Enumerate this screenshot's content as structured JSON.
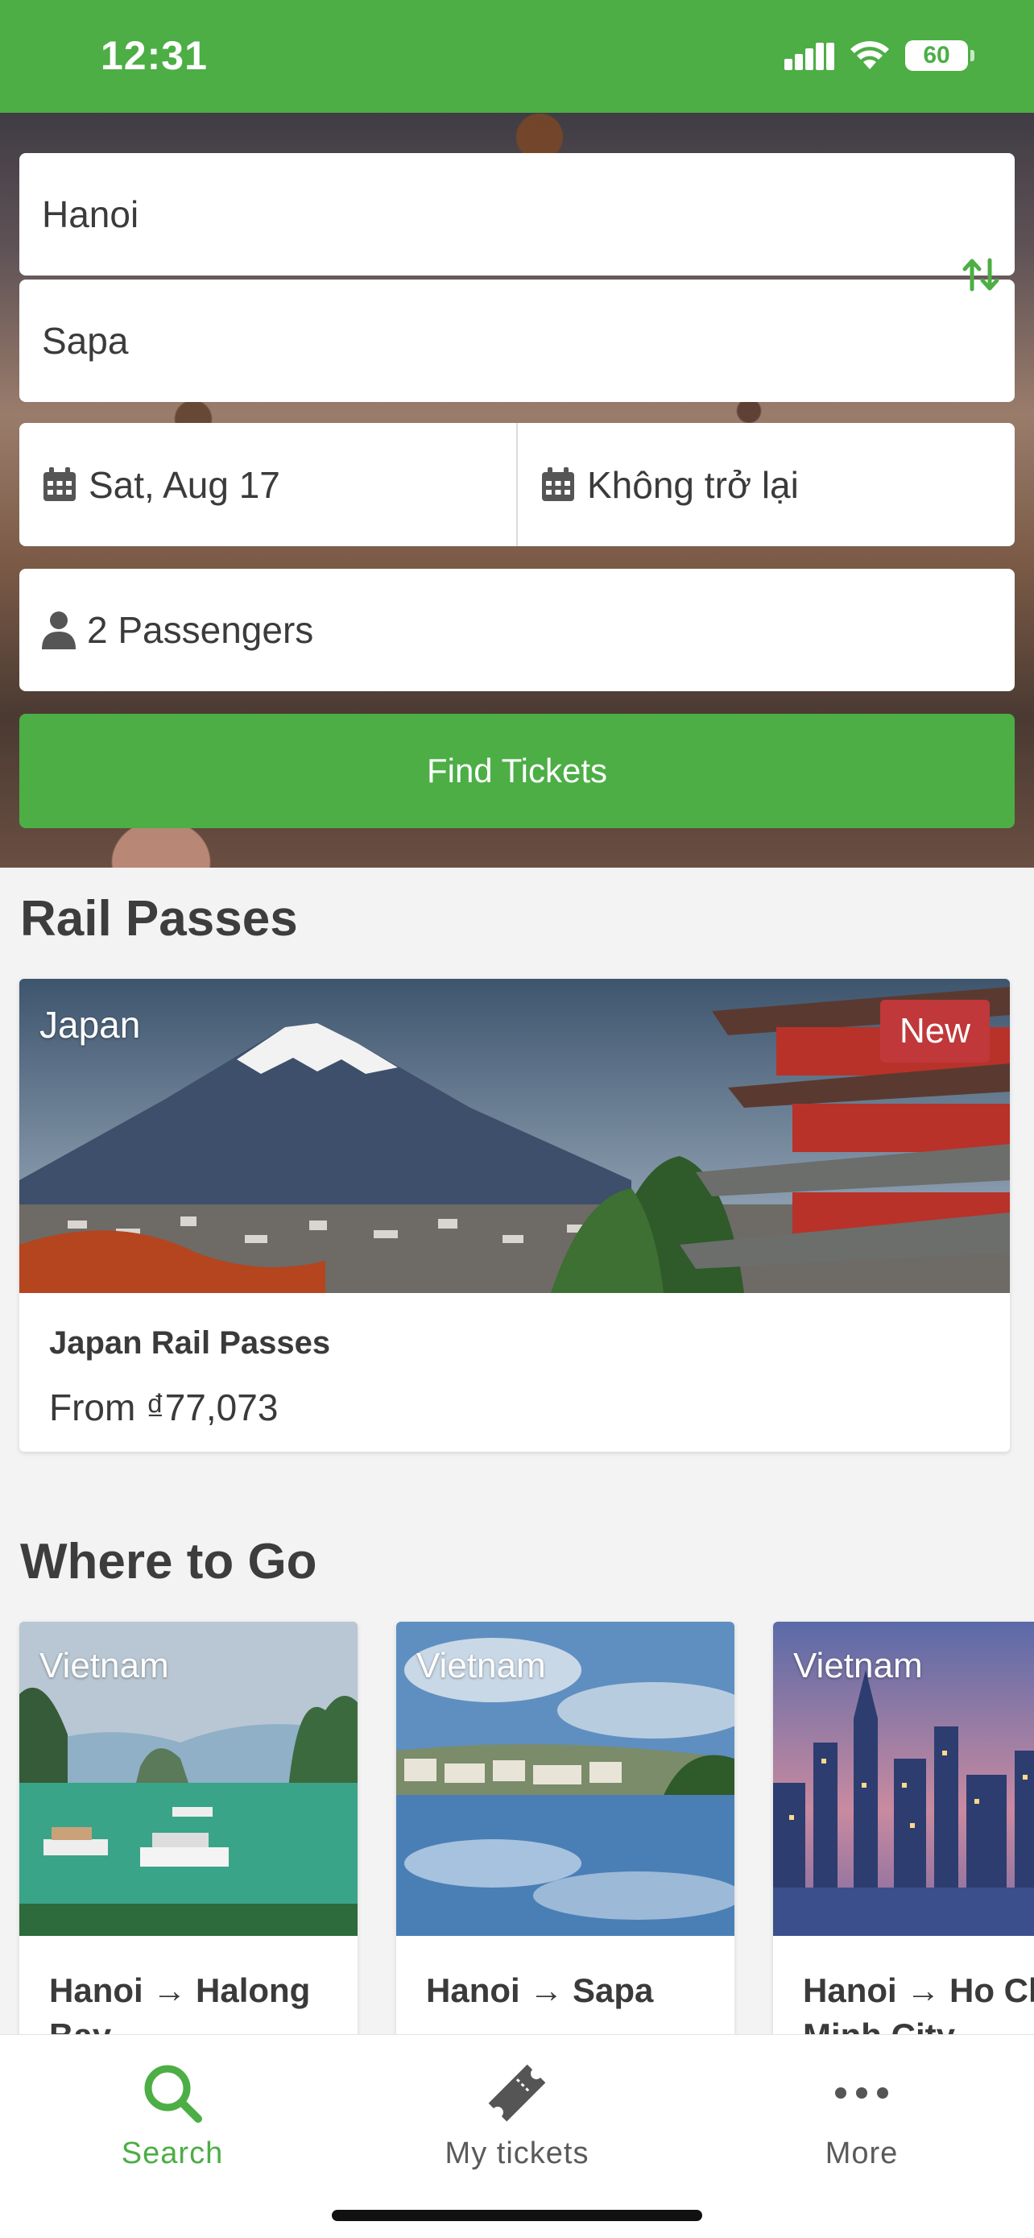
{
  "status_bar": {
    "time": "12:31",
    "battery": "60"
  },
  "search": {
    "from": "Hanoi",
    "to": "Sapa",
    "depart_date": "Sat, Aug 17",
    "return_date": "Không trở lại",
    "passengers": "2 Passengers",
    "find_label": "Find Tickets"
  },
  "rail_passes": {
    "title": "Rail Passes",
    "card": {
      "country": "Japan",
      "badge": "New",
      "name": "Japan Rail Passes",
      "price": "From ₫77,073"
    }
  },
  "where_to_go": {
    "title": "Where to Go",
    "cards": [
      {
        "country": "Vietnam",
        "route": "Hanoi → Halong Bay"
      },
      {
        "country": "Vietnam",
        "route": "Hanoi → Sapa"
      },
      {
        "country": "Vietnam",
        "route": "Hanoi → Ho Chi Minh City"
      }
    ]
  },
  "tab_bar": {
    "tabs": [
      {
        "label": "Search",
        "icon": "search-icon",
        "active": true
      },
      {
        "label": "My tickets",
        "icon": "ticket-icon",
        "active": false
      },
      {
        "label": "More",
        "icon": "more-icon",
        "active": false
      }
    ]
  },
  "colors": {
    "brand_green": "#4cae45",
    "badge_red": "#c0383a"
  }
}
